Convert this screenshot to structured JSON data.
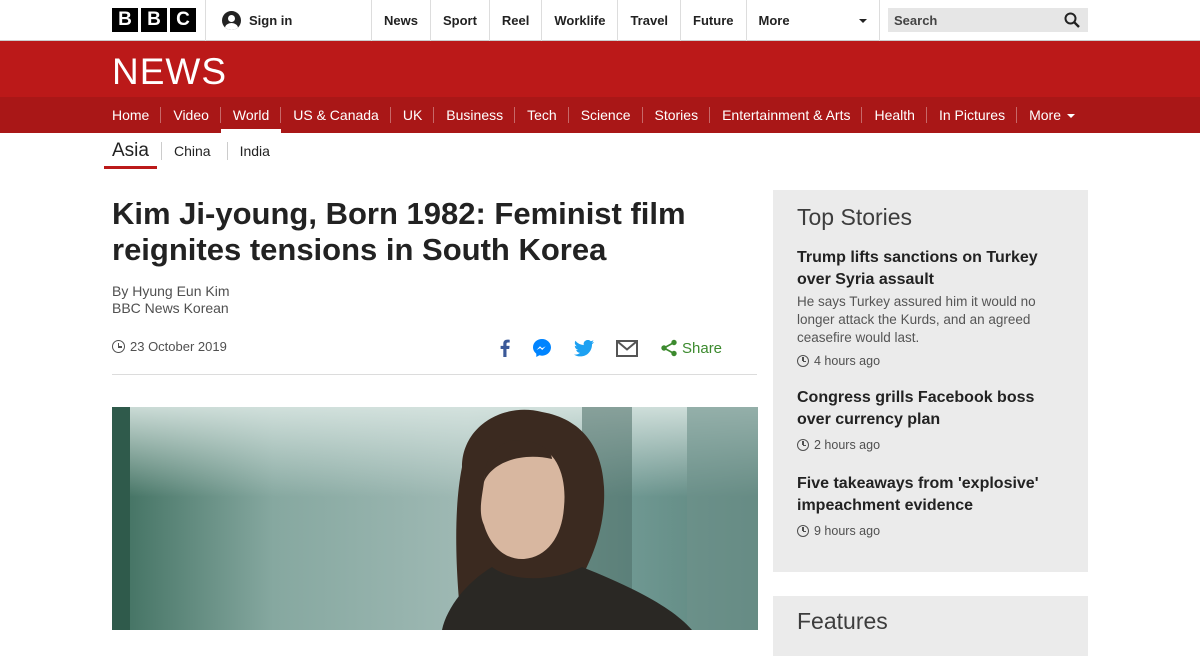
{
  "topbar": {
    "logo_letters": [
      "B",
      "B",
      "C"
    ],
    "signin_label": "Sign in",
    "nav": [
      "News",
      "Sport",
      "Reel",
      "Worklife",
      "Travel",
      "Future"
    ],
    "more_label": "More",
    "search_placeholder": "Search"
  },
  "brand": {
    "news_logo": "NEWS",
    "red": "#bb1919",
    "dark_red": "#a91717"
  },
  "mainnav": {
    "items": [
      "Home",
      "Video",
      "World",
      "US & Canada",
      "UK",
      "Business",
      "Tech",
      "Science",
      "Stories",
      "Entertainment & Arts",
      "Health",
      "In Pictures",
      "More"
    ],
    "active": "World"
  },
  "subnav": {
    "current": "Asia",
    "items": [
      "China",
      "India"
    ]
  },
  "article": {
    "headline": "Kim Ji-young, Born 1982: Feminist film reignites tensions in South Korea",
    "author": "By Hyung Eun Kim",
    "outlet": "BBC News Korean",
    "date": "23 October 2019",
    "share_label": "Share",
    "share_icons": [
      "facebook-icon",
      "messenger-icon",
      "twitter-icon",
      "email-icon",
      "share-icon"
    ]
  },
  "sidebar": {
    "top_stories_title": "Top Stories",
    "stories": [
      {
        "headline": "Trump lifts sanctions on Turkey over Syria assault",
        "summary": "He says Turkey assured him it would no longer attack the Kurds, and an agreed ceasefire would last.",
        "time": "4 hours ago"
      },
      {
        "headline": "Congress grills Facebook boss over currency plan",
        "summary": "",
        "time": "2 hours ago"
      },
      {
        "headline": "Five takeaways from 'explosive' impeachment evidence",
        "summary": "",
        "time": "9 hours ago"
      }
    ],
    "features_title": "Features"
  }
}
